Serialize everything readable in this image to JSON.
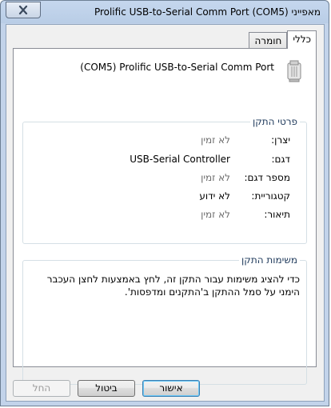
{
  "window": {
    "title": "מאפייני (COM5) Prolific USB-to-Serial Comm Port"
  },
  "tabs": [
    {
      "label": "כללי",
      "active": true
    },
    {
      "label": "חומרה",
      "active": false
    }
  ],
  "device": {
    "name": "(COM5) Prolific USB-to-Serial Comm Port",
    "icon": "device-icon"
  },
  "details": {
    "group_label": "פרטי התקן",
    "rows": [
      {
        "label": "יצרן:",
        "value": "לא זמין",
        "muted": true
      },
      {
        "label": "דגם:",
        "value": "USB-Serial Controller",
        "muted": false
      },
      {
        "label": "מספר דגם:",
        "value": "לא זמין",
        "muted": true
      },
      {
        "label": "קטגוריית:",
        "value": "לא ידוע",
        "muted": false
      },
      {
        "label": "תיאור:",
        "value": "לא זמין",
        "muted": true
      }
    ]
  },
  "tasks": {
    "group_label": "משימות התקן",
    "text": "כדי להציג משימות עבור התקן זה, לחץ באמצעות לחצן העכבר הימני על סמל ההתקן ב'התקנים ומדפסות'."
  },
  "buttons": {
    "ok": "אישור",
    "cancel": "ביטול",
    "apply": "החל"
  },
  "colors": {
    "title_bar": "#b9cde6",
    "group_label": "#1e395b",
    "muted_text": "#6d6d6d"
  }
}
